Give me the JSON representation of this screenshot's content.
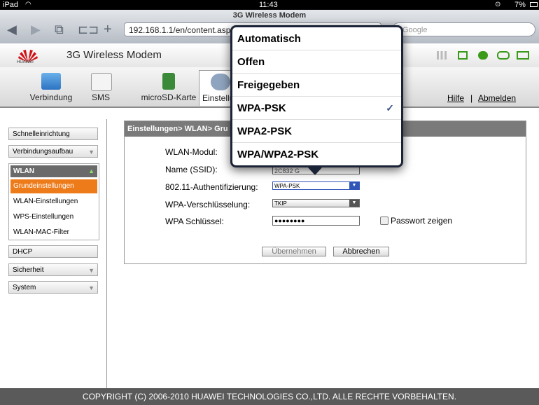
{
  "status_bar": {
    "device": "iPad",
    "time": "11:43",
    "battery": "7%"
  },
  "browser": {
    "page_title": "3G Wireless Modem",
    "url": "192.168.1.1/en/content.asp",
    "search_placeholder": "Google"
  },
  "header": {
    "brand": "HUAWEI",
    "title": "3G Wireless Modem"
  },
  "tabs": [
    {
      "label": "Verbindung"
    },
    {
      "label": "SMS"
    },
    {
      "label": "microSD-Karte"
    },
    {
      "label": "Einstellungen"
    }
  ],
  "top_links": {
    "help": "Hilfe",
    "separator": "|",
    "logout": "Abmelden"
  },
  "sidebar": {
    "quick_setup": "Schnelleinrichtung",
    "connection": "Verbindungsaufbau",
    "wlan": "WLAN",
    "wlan_items": [
      "Grundeinstellungen",
      "WLAN-Einstellungen",
      "WPS-Einstellungen",
      "WLAN-MAC-Filter"
    ],
    "dhcp": "DHCP",
    "security": "Sicherheit",
    "system": "System"
  },
  "panel": {
    "breadcrumb": "Einstellungen> WLAN> Gru",
    "fields": {
      "module_label": "WLAN-Modul:",
      "ssid_label": "Name (SSID):",
      "ssid_value": "2C832 G",
      "auth_label": "802.11-Authentifizierung:",
      "auth_value": "WPA-PSK",
      "enc_label": "WPA-Verschlüsselung:",
      "enc_value": "TKIP",
      "key_label": "WPA Schlüssel:",
      "key_value": "●●●●●●●●",
      "show_password": "Passwort zeigen"
    },
    "apply_button": "Übernehmen",
    "cancel_button": "Abbrechen"
  },
  "popover": {
    "options": [
      "Automatisch",
      "Offen",
      "Freigegeben",
      "WPA-PSK",
      "WPA2-PSK",
      "WPA/WPA2-PSK"
    ],
    "selected_index": 3,
    "checkmark": "✓"
  },
  "footer": {
    "text": "COPYRIGHT (C) 2006-2010 HUAWEI TECHNOLOGIES CO.,LTD. ALLE RECHTE VORBEHALTEN."
  },
  "colors": {
    "accent": "#ee7b1a",
    "popover_frame": "#1b2336",
    "panel_header": "#7a7a7a"
  }
}
